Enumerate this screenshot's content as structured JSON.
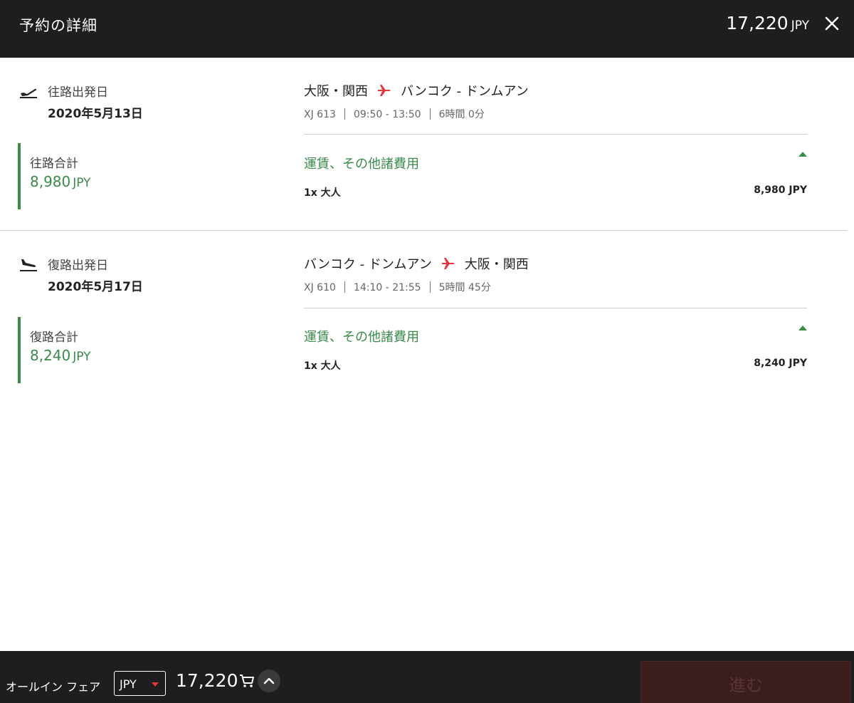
{
  "header": {
    "title": "予約の詳細",
    "total_amount": "17,220",
    "total_currency": "JPY"
  },
  "outbound": {
    "label": "往路出発日",
    "date": "2020年5月13日",
    "total_label": "往路合計",
    "total_amount": "8,980",
    "total_currency": "JPY",
    "origin": "大阪・関西",
    "destination": "バンコク - ドンムアン",
    "flight_no": "XJ 613",
    "time": "09:50 - 13:50",
    "duration": "6時間 0分",
    "fees_label": "運賃、その他諸費用",
    "pax": "1x 大人",
    "amount": "8,980 JPY"
  },
  "return": {
    "label": "復路出発日",
    "date": "2020年5月17日",
    "total_label": "復路合計",
    "total_amount": "8,240",
    "total_currency": "JPY",
    "origin": "バンコク - ドンムアン",
    "destination": "大阪・関西",
    "flight_no": "XJ 610",
    "time": "14:10 - 21:55",
    "duration": "5時間 45分",
    "fees_label": "運賃、その他諸費用",
    "pax": "1x 大人",
    "amount": "8,240 JPY"
  },
  "footer": {
    "fare_label": "オールイン フェア",
    "currency": "JPY",
    "total": "17,220",
    "proceed_label": "進む"
  },
  "colors": {
    "accent_green": "#3a8a4a",
    "plane_red": "#e0383e",
    "bar_dark": "#1e1e1e"
  },
  "icons": [
    "close-icon",
    "takeoff-icon",
    "landing-icon",
    "plane-icon",
    "caret-up-icon",
    "cart-icon",
    "chevron-up-icon",
    "dropdown-arrow-icon"
  ]
}
